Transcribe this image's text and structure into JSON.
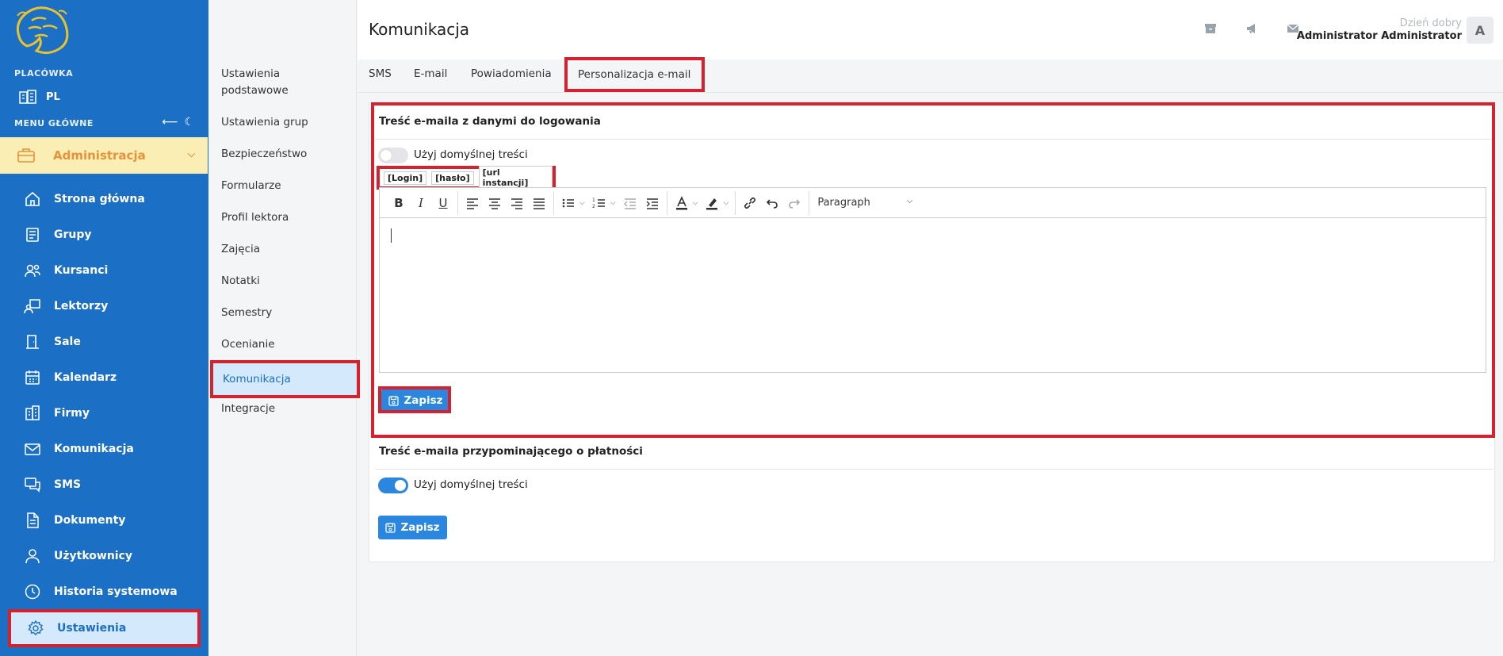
{
  "sidebar": {
    "branch_label": "PLACÓWKA",
    "branch_value": "PL",
    "menu_label": "MENU GŁÓWNE",
    "section_item": "Administracja",
    "items": [
      {
        "label": "Strona główna",
        "icon": "home-icon"
      },
      {
        "label": "Grupy",
        "icon": "book-icon"
      },
      {
        "label": "Kursanci",
        "icon": "users-icon"
      },
      {
        "label": "Lektorzy",
        "icon": "teacher-icon"
      },
      {
        "label": "Sale",
        "icon": "door-icon"
      },
      {
        "label": "Kalendarz",
        "icon": "calendar-icon"
      },
      {
        "label": "Firmy",
        "icon": "building-icon"
      },
      {
        "label": "Komunikacja",
        "icon": "envelope-icon"
      },
      {
        "label": "SMS",
        "icon": "chat-icon"
      },
      {
        "label": "Dokumenty",
        "icon": "document-icon"
      },
      {
        "label": "Użytkownicy",
        "icon": "user-icon"
      },
      {
        "label": "Historia systemowa",
        "icon": "clock-icon"
      },
      {
        "label": "Ustawienia",
        "icon": "gear-icon"
      }
    ]
  },
  "submenu": {
    "items": [
      "Ustawienia podstawowe",
      "Ustawienia grup",
      "Bezpieczeństwo",
      "Formularze",
      "Profil lektora",
      "Zajęcia",
      "Notatki",
      "Semestry",
      "Ocenianie",
      "Komunikacja",
      "Integracje"
    ]
  },
  "header": {
    "title": "Komunikacja",
    "greeting": "Dzień dobry",
    "username": "Administrator Administrator",
    "avatar": "A"
  },
  "tabs": [
    "SMS",
    "E-mail",
    "Powiadomienia",
    "Personalizacja e-mail"
  ],
  "card1": {
    "title": "Treść e-maila z danymi do logowania",
    "toggle_label": "Użyj domyślnej treści",
    "toggle_on": false,
    "tags": [
      "[Login]",
      "[hasło]",
      "[url instancji]"
    ],
    "paragraph": "Paragraph",
    "save": "Zapisz"
  },
  "card2": {
    "title": "Treść e-maila przypominającego o płatności",
    "toggle_label": "Użyj domyślnej treści",
    "toggle_on": true,
    "save": "Zapisz"
  },
  "colors": {
    "sidebar": "#1b6fc5",
    "accent": "#2a86de",
    "highlight": "#d6222e",
    "admin_bg": "#fbeeb4",
    "admin_text": "#e8923a"
  }
}
